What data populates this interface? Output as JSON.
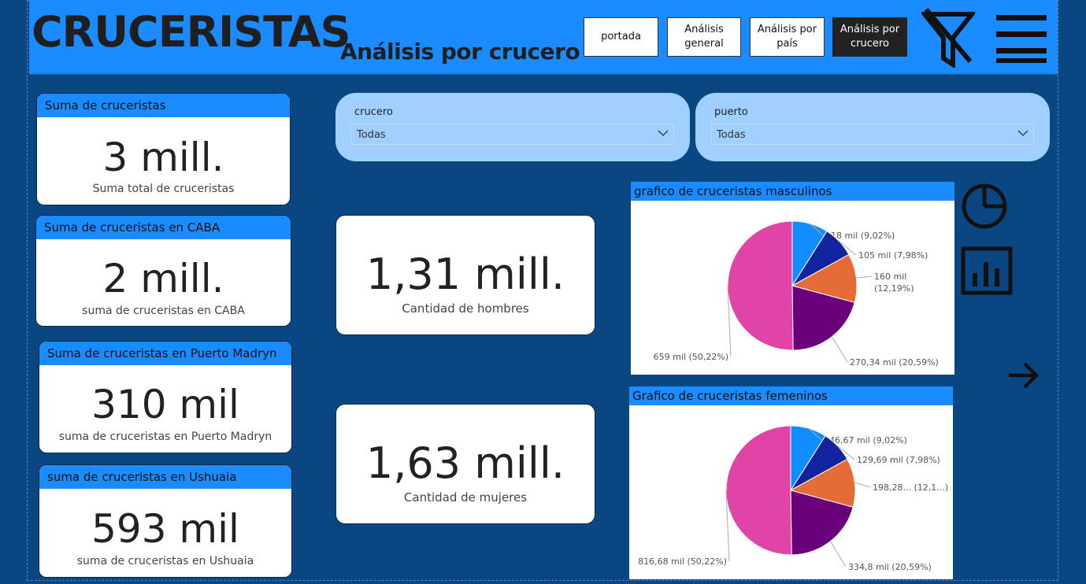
{
  "header": {
    "title": "CRUCERISTAS",
    "subtitle": "Análisis por crucero",
    "nav": [
      {
        "label": "portada",
        "active": false
      },
      {
        "label": "Análisis general",
        "active": false
      },
      {
        "label": "Análisis por país",
        "active": false
      },
      {
        "label": "Análisis por crucero",
        "active": true
      }
    ],
    "icons": [
      "filter-clear-icon",
      "hamburger-menu-icon"
    ]
  },
  "kpis_left": [
    {
      "head": "Suma de cruceristas",
      "value": "3 mill.",
      "label": "Suma total de cruceristas"
    },
    {
      "head": "Suma de cruceristas en CABA",
      "value": "2 mill.",
      "label": "suma de cruceristas en CABA"
    },
    {
      "head": "Suma de cruceristas en Puerto Madryn",
      "value": "310 mil",
      "label": "suma de cruceristas en Puerto Madryn"
    },
    {
      "head": "suma de cruceristas en Ushuaia",
      "value": "593 mil",
      "label": "suma de cruceristas en Ushuaia"
    }
  ],
  "kpis_mid": [
    {
      "value": "1,31 mill.",
      "label": "Cantidad de hombres"
    },
    {
      "value": "1,63 mill.",
      "label": "Cantidad de mujeres"
    }
  ],
  "slicers": [
    {
      "label": "crucero",
      "value": "Todas"
    },
    {
      "label": "puerto",
      "value": "Todas"
    }
  ],
  "side_icons": [
    "pie-chart-icon",
    "bar-chart-icon",
    "arrow-right-icon"
  ],
  "colors": {
    "header": "#1a8cff",
    "background": "#0a4782",
    "slice_blue": "#118dff",
    "slice_navy": "#12239e",
    "slice_orange": "#e66c37",
    "slice_purple": "#6b007b",
    "slice_pink": "#e044a7"
  },
  "chart_data": [
    {
      "type": "pie",
      "title": "grafico de cruceristas masculinos",
      "labels": [
        "118 mil (9,02%)",
        "105 mil (7,98%)",
        "160 mil (12,19%)",
        "270,34 mil (20,59%)",
        "659 mil (50,22%)"
      ],
      "values": [
        118,
        105,
        160,
        270.34,
        659
      ],
      "percents": [
        9.02,
        7.98,
        12.19,
        20.59,
        50.22
      ]
    },
    {
      "type": "pie",
      "title": "Grafico de cruceristas femeninos",
      "labels": [
        "146,67 mil (9,02%)",
        "129,69 mil (7,98%)",
        "198,28... (12,1...)",
        "334,8 mil (20,59%)",
        "816,68 mil (50,22%)"
      ],
      "values": [
        146.67,
        129.69,
        198.28,
        334.8,
        816.68
      ],
      "percents": [
        9.02,
        7.98,
        12.19,
        20.59,
        50.22
      ]
    }
  ]
}
